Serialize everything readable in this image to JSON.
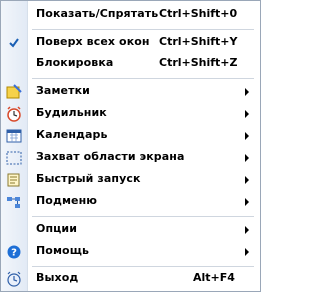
{
  "items": [
    {
      "label": "Показать/Спрятать",
      "shortcut": "Ctrl+Shift+0"
    },
    {
      "label": "Поверх всех окон",
      "shortcut": "Ctrl+Shift+Y",
      "icon": "checkmark-icon",
      "checked": true
    },
    {
      "label": "Блокировка",
      "shortcut": "Ctrl+Shift+Z"
    },
    {
      "label": "Заметки",
      "icon": "notes-icon",
      "submenu": true
    },
    {
      "label": "Будильник",
      "icon": "alarm-clock-icon",
      "submenu": true
    },
    {
      "label": "Календарь",
      "icon": "calendar-icon",
      "submenu": true
    },
    {
      "label": "Захват области экрана",
      "icon": "screen-capture-icon",
      "submenu": true
    },
    {
      "label": "Быстрый запуск",
      "icon": "quick-launch-icon",
      "submenu": true
    },
    {
      "label": "Подменю",
      "icon": "submenu-icon",
      "submenu": true
    },
    {
      "label": "Опции",
      "submenu": true
    },
    {
      "label": "Помощь",
      "icon": "help-icon",
      "submenu": true
    },
    {
      "label": "Выход",
      "shortcut": "Alt+F4",
      "icon": "exit-icon"
    }
  ],
  "colors": {
    "border": "#9aa7b8",
    "gutter": "#e6edf6",
    "check": "#1a5fb4",
    "help": "#1e6fd6"
  }
}
